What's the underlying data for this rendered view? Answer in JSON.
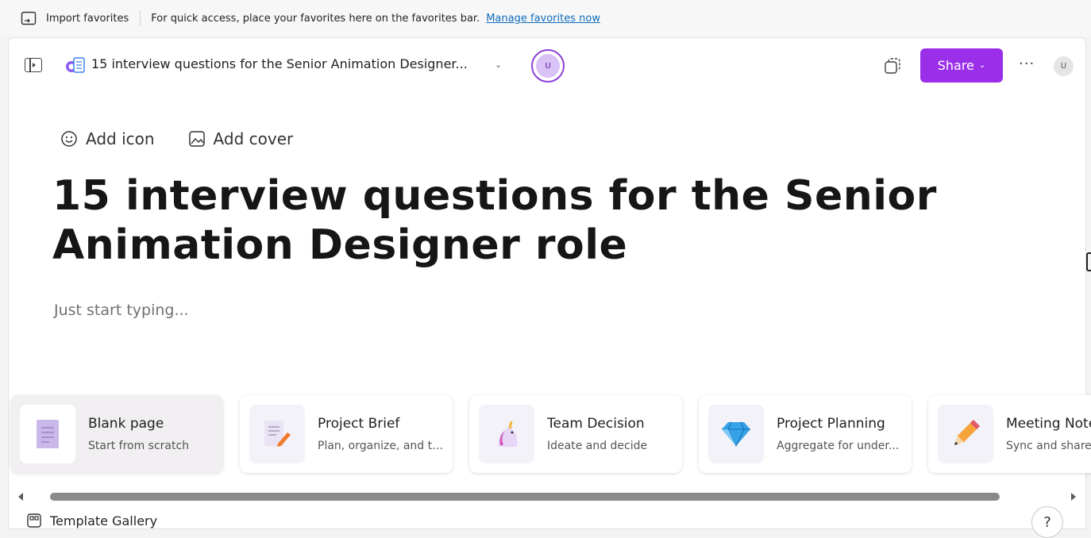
{
  "favorites_bar": {
    "import_label": "Import favorites",
    "message": "For quick access, place your favorites here on the favorites bar.",
    "manage_link": "Manage favorites now"
  },
  "header": {
    "doc_title": "15 interview questions for the Senior Animation Designer...",
    "presence_initial": "U",
    "share_label": "Share",
    "more_label": "···",
    "user_initial": "U"
  },
  "page": {
    "add_icon_label": "Add icon",
    "add_cover_label": "Add cover",
    "title": "15 interview questions for the Senior Animation Designer role",
    "placeholder": "Just start typing..."
  },
  "templates": [
    {
      "name": "Blank page",
      "desc": "Start from scratch",
      "icon": "blank-page-icon"
    },
    {
      "name": "Project Brief",
      "desc": "Plan, organize, and tr...",
      "icon": "document-pencil-icon"
    },
    {
      "name": "Team Decision",
      "desc": "Ideate and decide",
      "icon": "unicorn-icon"
    },
    {
      "name": "Project Planning",
      "desc": "Aggregate for under...",
      "icon": "gem-icon"
    },
    {
      "name": "Meeting Notes",
      "desc": "Sync and share",
      "icon": "pencil-icon"
    }
  ],
  "gallery_label": "Template Gallery",
  "help_label": "?",
  "colors": {
    "accent": "#9b2ee8",
    "link": "#0f6cbd"
  }
}
